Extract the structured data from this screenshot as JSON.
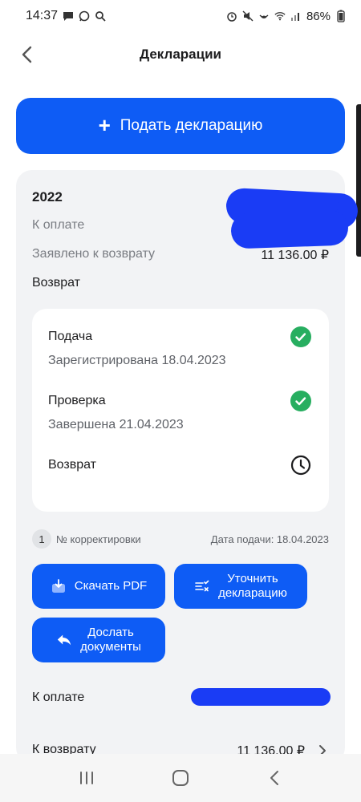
{
  "status_bar": {
    "time": "14:37",
    "battery": "86%"
  },
  "header": {
    "title": "Декларации"
  },
  "primary_action": {
    "label": "Подать декларацию"
  },
  "declaration": {
    "year": "2022",
    "to_pay_label": "К оплате",
    "declared_refund_label": "Заявлено к возврату",
    "declared_refund_value": "11 136.00 ₽",
    "refund_section_label": "Возврат",
    "steps": [
      {
        "title": "Подача",
        "subtitle": "Зарегистрирована 18.04.2023",
        "status_icon": "check-circle-icon"
      },
      {
        "title": "Проверка",
        "subtitle": "Завершена 21.04.2023",
        "status_icon": "check-circle-icon"
      },
      {
        "title": "Возврат",
        "subtitle": "",
        "status_icon": "clock-icon"
      }
    ],
    "correction_number": "1",
    "correction_label": "№ корректировки",
    "submission_date": "Дата подачи: 18.04.2023",
    "actions": {
      "download_pdf": "Скачать PDF",
      "clarify_line1": "Уточнить",
      "clarify_line2": "декларацию",
      "send_docs_line1": "Дослать",
      "send_docs_line2": "документы"
    },
    "to_pay_bottom_label": "К оплате",
    "refund_bottom_label": "К возврату",
    "refund_bottom_value": "11 136.00 ₽"
  },
  "colors": {
    "accent": "#0e5cf5",
    "success": "#27ae60",
    "card_bg": "#f2f3f5",
    "redaction": "#1a3cf5"
  }
}
